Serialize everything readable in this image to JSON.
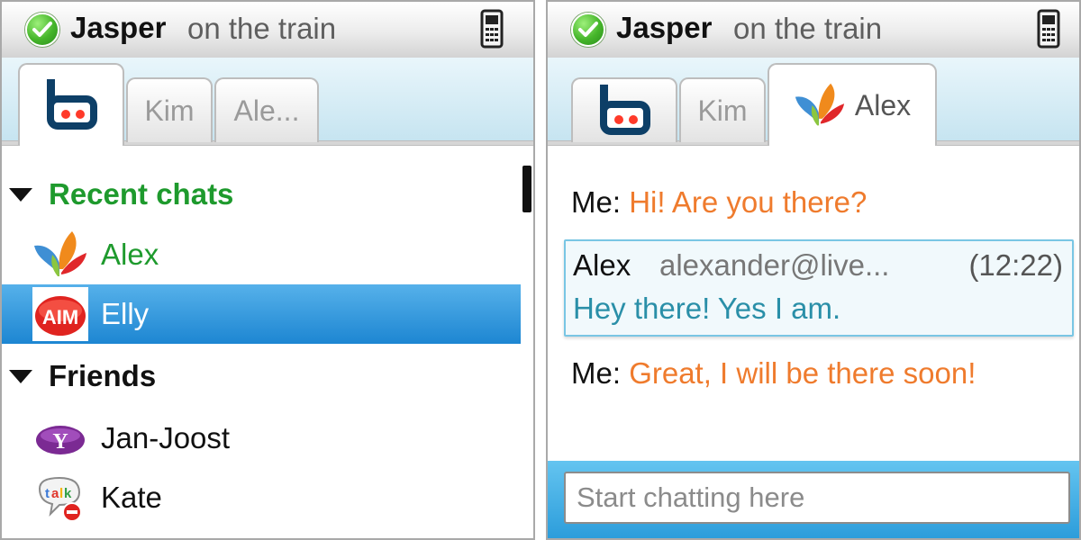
{
  "colors": {
    "status_check": "#45b52a",
    "selection": "#2b91d8",
    "group_green": "#1e9a2d",
    "my_message": "#ef7b2d",
    "their_message": "#2a8fa8",
    "input_bar": "#3eaae3"
  },
  "status": {
    "name": "Jasper",
    "message": "on the train",
    "icon": "check-circle-icon",
    "device_icon": "mobile-phone-icon"
  },
  "left_screen": {
    "tabs": [
      {
        "label": "",
        "icon": "bebo-logo-icon",
        "active": true
      },
      {
        "label": "Kim",
        "active": false
      },
      {
        "label": "Ale...",
        "active": false
      }
    ],
    "groups": [
      {
        "title": "Recent chats",
        "contacts": [
          {
            "name": "Alex",
            "service_icon": "msn-butterfly-icon",
            "selected": false
          },
          {
            "name": "Elly",
            "service_icon": "aim-icon",
            "selected": true
          }
        ]
      },
      {
        "title": "Friends",
        "contacts": [
          {
            "name": "Jan-Joost",
            "service_icon": "yahoo-icon",
            "selected": false
          },
          {
            "name": "Kate",
            "service_icon": "gtalk-icon",
            "selected": false
          }
        ]
      }
    ]
  },
  "right_screen": {
    "tabs": [
      {
        "label": "",
        "icon": "bebo-logo-icon",
        "active": false
      },
      {
        "label": "Kim",
        "active": false
      },
      {
        "label": "Alex",
        "icon": "msn-butterfly-icon",
        "active": true
      }
    ],
    "messages": [
      {
        "sender": "Me:",
        "text": "Hi! Are you there?"
      },
      {
        "sender": "Alex",
        "address": "alexander@live...",
        "time": "(12:22)",
        "text": "Hey there! Yes I am."
      },
      {
        "sender": "Me:",
        "text": "Great, I will be there soon!"
      }
    ],
    "input": {
      "placeholder": "Start chatting here",
      "value": ""
    }
  }
}
